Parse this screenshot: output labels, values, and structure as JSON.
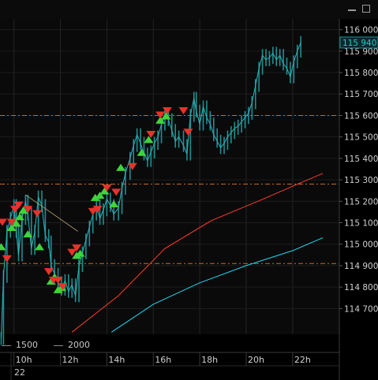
{
  "window": {
    "minimize_icon": "minimize-icon",
    "maximize_icon": "maximize-icon"
  },
  "legend": {
    "items": [
      "1500",
      "2000"
    ]
  },
  "chart_data": {
    "type": "candlestick",
    "ylim": [
      114580,
      116050
    ],
    "y_ticks": [
      116000,
      115900,
      115800,
      115700,
      115600,
      115500,
      115400,
      115300,
      115200,
      115100,
      115000,
      114900,
      114800,
      114700
    ],
    "y_tick_labels": [
      "116 000",
      "115 900",
      "115 800",
      "115 700",
      "115 600",
      "115 500",
      "115 400",
      "115 300",
      "115 200",
      "115 100",
      "115 000",
      "114 900",
      "114 800",
      "114 700"
    ],
    "current_price": 115940,
    "current_price_label": "115 940",
    "x_ticks": [
      {
        "label": "10h",
        "t": 10
      },
      {
        "label": "12h",
        "t": 12
      },
      {
        "label": "14h",
        "t": 14
      },
      {
        "label": "16h",
        "t": 16
      },
      {
        "label": "18h",
        "t": 18
      },
      {
        "label": "20h",
        "t": 20
      },
      {
        "label": "22h",
        "t": 22
      }
    ],
    "x_range": [
      9.4,
      23.5
    ],
    "date_label": "22",
    "horizontal_levels": [
      115600,
      115280,
      114910
    ],
    "price_points": [
      [
        9.45,
        114560
      ],
      [
        9.55,
        114850
      ],
      [
        9.7,
        115060
      ],
      [
        9.85,
        115120
      ],
      [
        10.0,
        115180
      ],
      [
        10.1,
        115060
      ],
      [
        10.2,
        114950
      ],
      [
        10.35,
        115120
      ],
      [
        10.5,
        115200
      ],
      [
        10.6,
        115140
      ],
      [
        10.75,
        114980
      ],
      [
        10.9,
        115060
      ],
      [
        11.05,
        115220
      ],
      [
        11.2,
        115180
      ],
      [
        11.35,
        115040
      ],
      [
        11.5,
        115010
      ],
      [
        11.6,
        114900
      ],
      [
        11.75,
        114860
      ],
      [
        11.9,
        114820
      ],
      [
        12.05,
        114790
      ],
      [
        12.2,
        114830
      ],
      [
        12.35,
        114780
      ],
      [
        12.5,
        114810
      ],
      [
        12.65,
        114760
      ],
      [
        12.8,
        114900
      ],
      [
        12.95,
        114960
      ],
      [
        13.1,
        115020
      ],
      [
        13.25,
        115080
      ],
      [
        13.4,
        115140
      ],
      [
        13.55,
        115180
      ],
      [
        13.7,
        115120
      ],
      [
        13.85,
        115160
      ],
      [
        14.0,
        115210
      ],
      [
        14.15,
        115180
      ],
      [
        14.3,
        115140
      ],
      [
        14.5,
        115170
      ],
      [
        14.65,
        115260
      ],
      [
        14.8,
        115330
      ],
      [
        15.0,
        115400
      ],
      [
        15.15,
        115460
      ],
      [
        15.3,
        115510
      ],
      [
        15.45,
        115470
      ],
      [
        15.6,
        115420
      ],
      [
        15.75,
        115390
      ],
      [
        15.9,
        115430
      ],
      [
        16.05,
        115470
      ],
      [
        16.2,
        115500
      ],
      [
        16.35,
        115560
      ],
      [
        16.5,
        115600
      ],
      [
        16.65,
        115580
      ],
      [
        16.8,
        115530
      ],
      [
        16.95,
        115480
      ],
      [
        17.1,
        115500
      ],
      [
        17.3,
        115460
      ],
      [
        17.45,
        115420
      ],
      [
        17.6,
        115600
      ],
      [
        17.75,
        115680
      ],
      [
        17.85,
        115620
      ],
      [
        18.0,
        115560
      ],
      [
        18.15,
        115640
      ],
      [
        18.3,
        115590
      ],
      [
        18.45,
        115560
      ],
      [
        18.6,
        115510
      ],
      [
        18.75,
        115480
      ],
      [
        18.9,
        115450
      ],
      [
        19.05,
        115470
      ],
      [
        19.2,
        115500
      ],
      [
        19.35,
        115520
      ],
      [
        19.5,
        115540
      ],
      [
        19.65,
        115550
      ],
      [
        19.8,
        115570
      ],
      [
        19.95,
        115590
      ],
      [
        20.1,
        115610
      ],
      [
        20.25,
        115660
      ],
      [
        20.4,
        115740
      ],
      [
        20.55,
        115820
      ],
      [
        20.7,
        115880
      ],
      [
        20.85,
        115860
      ],
      [
        21.0,
        115870
      ],
      [
        21.15,
        115890
      ],
      [
        21.3,
        115860
      ],
      [
        21.45,
        115880
      ],
      [
        21.6,
        115840
      ],
      [
        21.75,
        115820
      ],
      [
        21.9,
        115780
      ],
      [
        22.05,
        115850
      ],
      [
        22.2,
        115900
      ],
      [
        22.35,
        115940
      ]
    ],
    "buy_signals": [
      [
        9.45,
        114990
      ],
      [
        9.9,
        115080
      ],
      [
        10.1,
        115100
      ],
      [
        10.25,
        115130
      ],
      [
        10.4,
        115160
      ],
      [
        10.6,
        115050
      ],
      [
        11.1,
        114990
      ],
      [
        11.6,
        114830
      ],
      [
        11.75,
        114850
      ],
      [
        11.9,
        114790
      ],
      [
        12.05,
        114800
      ],
      [
        12.7,
        114950
      ],
      [
        12.85,
        114960
      ],
      [
        13.5,
        115220
      ],
      [
        13.7,
        115230
      ],
      [
        13.9,
        115250
      ],
      [
        14.3,
        115190
      ],
      [
        14.6,
        115360
      ],
      [
        15.5,
        115430
      ],
      [
        15.8,
        115490
      ],
      [
        16.3,
        115580
      ],
      [
        16.55,
        115600
      ]
    ],
    "sell_signals": [
      [
        9.5,
        115100
      ],
      [
        9.7,
        114930
      ],
      [
        9.9,
        115100
      ],
      [
        10.05,
        115160
      ],
      [
        10.2,
        115180
      ],
      [
        10.6,
        115160
      ],
      [
        11.0,
        115140
      ],
      [
        11.5,
        114870
      ],
      [
        11.7,
        114830
      ],
      [
        11.9,
        114830
      ],
      [
        12.1,
        114800
      ],
      [
        12.5,
        114960
      ],
      [
        12.7,
        114980
      ],
      [
        13.4,
        115150
      ],
      [
        13.6,
        115160
      ],
      [
        14.0,
        115260
      ],
      [
        14.4,
        115240
      ],
      [
        15.1,
        115360
      ],
      [
        15.9,
        115510
      ],
      [
        16.3,
        115600
      ],
      [
        16.6,
        115620
      ],
      [
        17.3,
        115620
      ],
      [
        17.5,
        115520
      ]
    ],
    "series": [
      {
        "name": "1500",
        "color": "#ff3b2f",
        "points": [
          [
            12.5,
            114590
          ],
          [
            14.5,
            114760
          ],
          [
            16.5,
            114980
          ],
          [
            18.5,
            115110
          ],
          [
            20.5,
            115200
          ],
          [
            22.0,
            115270
          ],
          [
            23.3,
            115330
          ]
        ]
      },
      {
        "name": "2000",
        "color": "#25d6f2",
        "points": [
          [
            14.2,
            114590
          ],
          [
            16.0,
            114720
          ],
          [
            18.0,
            114820
          ],
          [
            20.0,
            114900
          ],
          [
            22.0,
            114970
          ],
          [
            23.3,
            115030
          ]
        ]
      }
    ],
    "trendline": [
      [
        10.5,
        115230
      ],
      [
        12.75,
        115060
      ]
    ]
  }
}
